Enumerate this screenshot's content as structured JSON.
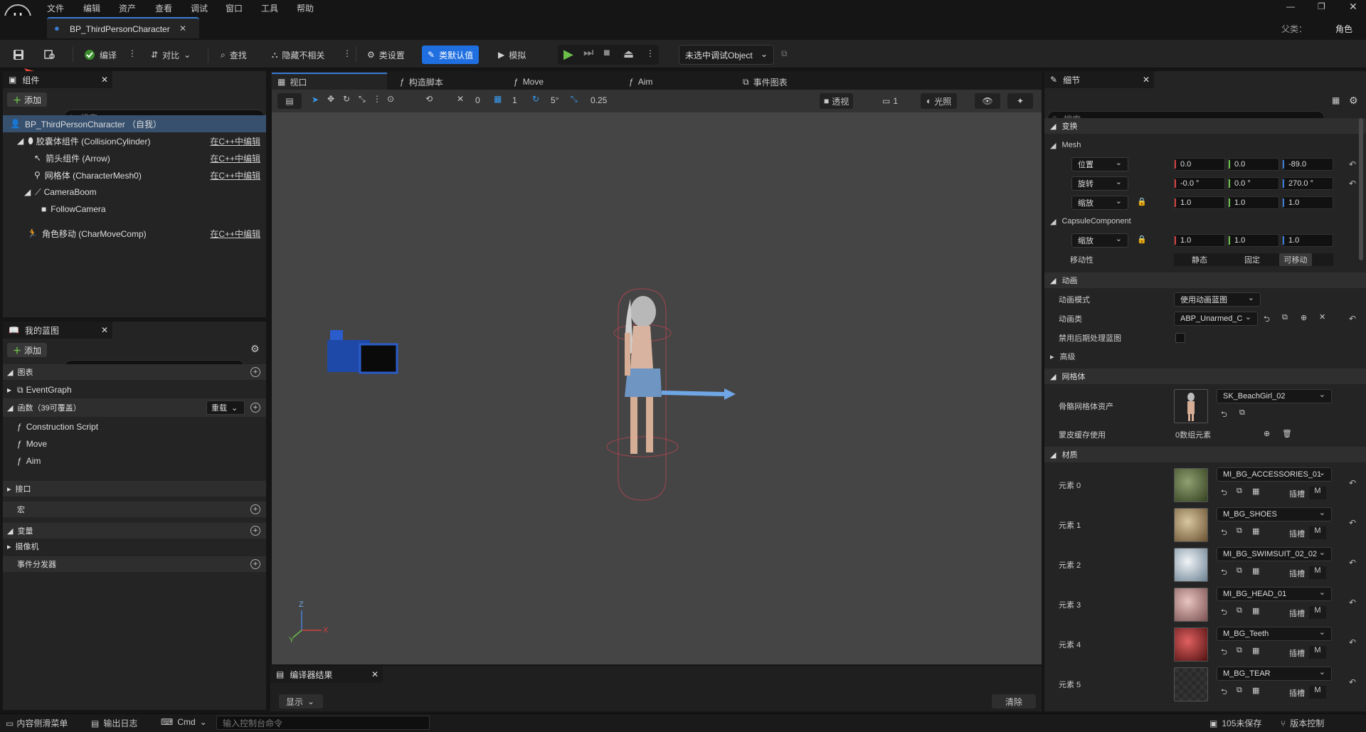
{
  "menu": [
    "文件",
    "编辑",
    "资产",
    "查看",
    "调试",
    "窗口",
    "工具",
    "帮助"
  ],
  "doc_tab": "BP_ThirdPersonCharacter",
  "parent_label": "父类：",
  "parent_value": "角色",
  "toolbar": {
    "compile": "编译",
    "diff": "对比",
    "find": "查找",
    "hide_unrelated": "隐藏不相关",
    "class_settings": "类设置",
    "class_defaults": "类默认值",
    "simulate": "模拟",
    "debug_object": "未选中调试Object"
  },
  "annotations": {
    "save": "保存",
    "compile": "编译"
  },
  "components": {
    "tab": "组件",
    "add": "添加",
    "search_placeholder": "搜索",
    "root": "BP_ThirdPersonCharacter （自我）",
    "items": [
      {
        "label": "胶囊体组件 (CollisionCylinder)",
        "edit": "在C++中编辑"
      },
      {
        "label": "箭头组件 (Arrow)",
        "edit": "在C++中编辑"
      },
      {
        "label": "网格体 (CharacterMesh0)",
        "edit": "在C++中编辑"
      },
      {
        "label": "CameraBoom",
        "edit": ""
      },
      {
        "label": "FollowCamera",
        "edit": ""
      },
      {
        "label": "角色移动 (CharMoveComp)",
        "edit": "在C++中编辑"
      }
    ]
  },
  "my_blueprint": {
    "tab": "我的蓝图",
    "add": "添加",
    "search_placeholder": "搜索",
    "graphs": "图表",
    "event_graph": "EventGraph",
    "functions": "函数（39可覆盖）",
    "override": "重载",
    "function_items": [
      "Construction Script",
      "Move",
      "Aim"
    ],
    "interfaces": "接口",
    "macros": "宏",
    "variables": "变量",
    "camera": "摄像机",
    "dispatchers": "事件分发器"
  },
  "editor_tabs": [
    "视口",
    "构造脚本",
    "Move",
    "Aim",
    "事件图表"
  ],
  "viewport_toolbar": {
    "snap_rot": "0",
    "grid": "1",
    "angle": "5°",
    "scale": "0.25",
    "perspective": "透视",
    "layers": "1",
    "lit": "光照"
  },
  "axes": {
    "z": "Z",
    "x": "X",
    "y": "Y"
  },
  "compiler": {
    "tab": "编译器结果",
    "show": "显示",
    "clear": "清除"
  },
  "details": {
    "tab": "细节",
    "search_placeholder": "搜索",
    "transform": "变换",
    "mesh": "Mesh",
    "location": "位置",
    "rotation": "旋转",
    "scale": "缩放",
    "loc_vals": [
      "0.0",
      "0.0",
      "-89.0"
    ],
    "rot_vals": [
      "-0.0 °",
      "0.0 °",
      "270.0 °"
    ],
    "scale_vals": [
      "1.0",
      "1.0",
      "1.0"
    ],
    "capsule": "CapsuleComponent",
    "cap_scale_vals": [
      "1.0",
      "1.0",
      "1.0"
    ],
    "mobility": "移动性",
    "mobility_opts": [
      "静态",
      "固定",
      "可移动"
    ],
    "animation": "动画",
    "anim_mode": "动画模式",
    "anim_mode_val": "使用动画蓝图",
    "anim_class": "动画类",
    "anim_class_val": "ABP_Unarmed_C",
    "disable_post": "禁用后期处理蓝图",
    "advanced": "高级",
    "mesh_sec": "网格体",
    "skeletal_asset": "骨骼网格体资产",
    "skeletal_val": "SK_BeachGirl_02",
    "skin_cache": "蒙皮缓存使用",
    "skin_cache_val": "0数组元素",
    "materials": "材质",
    "slot_label": "插槽",
    "m_label": "M",
    "material_items": [
      {
        "label": "元素 0",
        "value": "MI_BG_ACCESSORIES_01"
      },
      {
        "label": "元素 1",
        "value": "M_BG_SHOES"
      },
      {
        "label": "元素 2",
        "value": "MI_BG_SWIMSUIT_02_02"
      },
      {
        "label": "元素 3",
        "value": "MI_BG_HEAD_01"
      },
      {
        "label": "元素 4",
        "value": "M_BG_Teeth"
      },
      {
        "label": "元素 5",
        "value": "M_BG_TEAR"
      }
    ]
  },
  "status": {
    "content_drawer": "内容侧滑菜单",
    "output_log": "输出日志",
    "cmd": "Cmd",
    "console_placeholder": "输入控制台命令",
    "unsaved": "105未保存",
    "source_control": "版本控制"
  },
  "colors": {
    "accent": "#1f6fe0",
    "play": "#6cc04a",
    "annotation": "#e8463a"
  }
}
